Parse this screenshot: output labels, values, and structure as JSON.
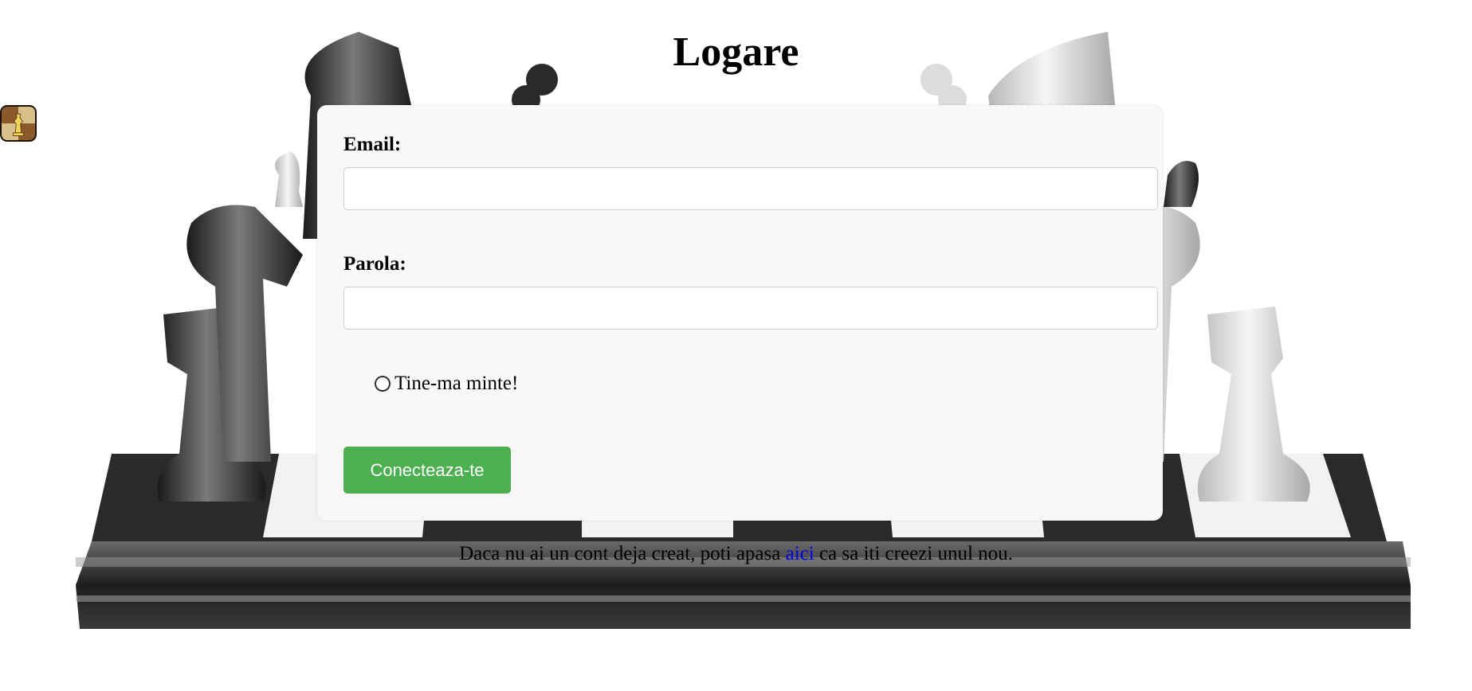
{
  "page": {
    "title": "Logare",
    "accent_color": "#4caf50",
    "link_color": "#0000ee",
    "logo_icon": "chess-logo-icon"
  },
  "form": {
    "email_label": "Email:",
    "email_value": "",
    "password_label": "Parola:",
    "password_value": "",
    "remember_label": "Tine-ma minte!",
    "remember_checked": false,
    "submit_label": "Conecteaza-te"
  },
  "footer": {
    "text_before": "Daca nu ai un cont deja creat, poti apasa ",
    "link_text": "aici",
    "text_after": " ca sa iti creezi unul nou."
  },
  "background": {
    "image": "chess-board-background"
  }
}
